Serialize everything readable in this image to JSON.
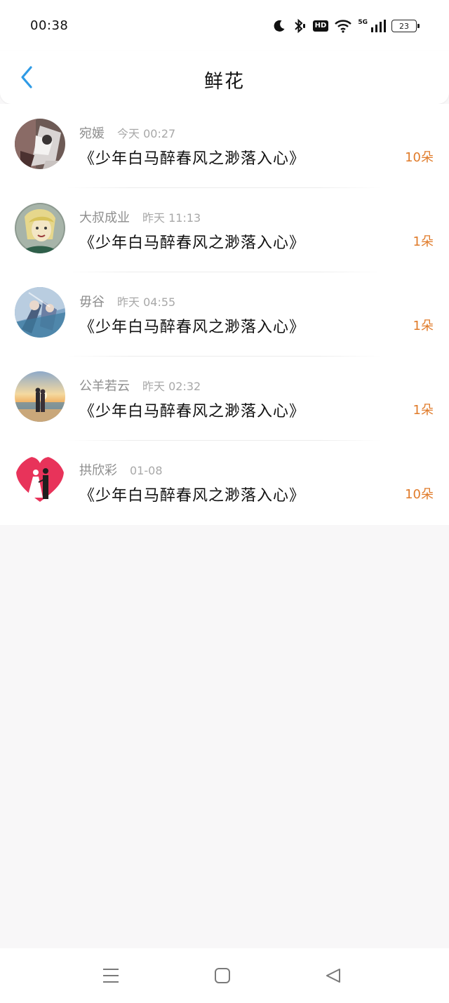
{
  "status_bar": {
    "time": "00:38",
    "network": "5G",
    "hd_label": "HD",
    "battery": "23",
    "icons": [
      "moon-icon",
      "bluetooth-icon",
      "hd-icon",
      "wifi-icon",
      "signal-icon",
      "battery-icon"
    ]
  },
  "header": {
    "title": "鲜花",
    "back_icon": "chevron-left-icon",
    "accent": "#2f9be6"
  },
  "colors": {
    "count": "#e07b2a",
    "name": "#8e8e8e",
    "time": "#a8a8a8",
    "background": "#f8f7f8"
  },
  "entries": [
    {
      "name": "宛媛",
      "time": "今天 00:27",
      "title": "《少年白马醉春风之渺落入心》",
      "count": "10朵"
    },
    {
      "name": "大叔成业",
      "time": "昨天 11:13",
      "title": "《少年白马醉春风之渺落入心》",
      "count": "1朵"
    },
    {
      "name": "毋谷",
      "time": "昨天 04:55",
      "title": "《少年白马醉春风之渺落入心》",
      "count": "1朵"
    },
    {
      "name": "公羊若云",
      "time": "昨天 02:32",
      "title": "《少年白马醉春风之渺落入心》",
      "count": "1朵"
    },
    {
      "name": "拱欣彩",
      "time": "01-08",
      "title": "《少年白马醉春风之渺落入心》",
      "count": "10朵"
    }
  ],
  "nav_bar": {
    "icons": [
      "menu-icon",
      "home-square-icon",
      "back-triangle-icon"
    ]
  }
}
